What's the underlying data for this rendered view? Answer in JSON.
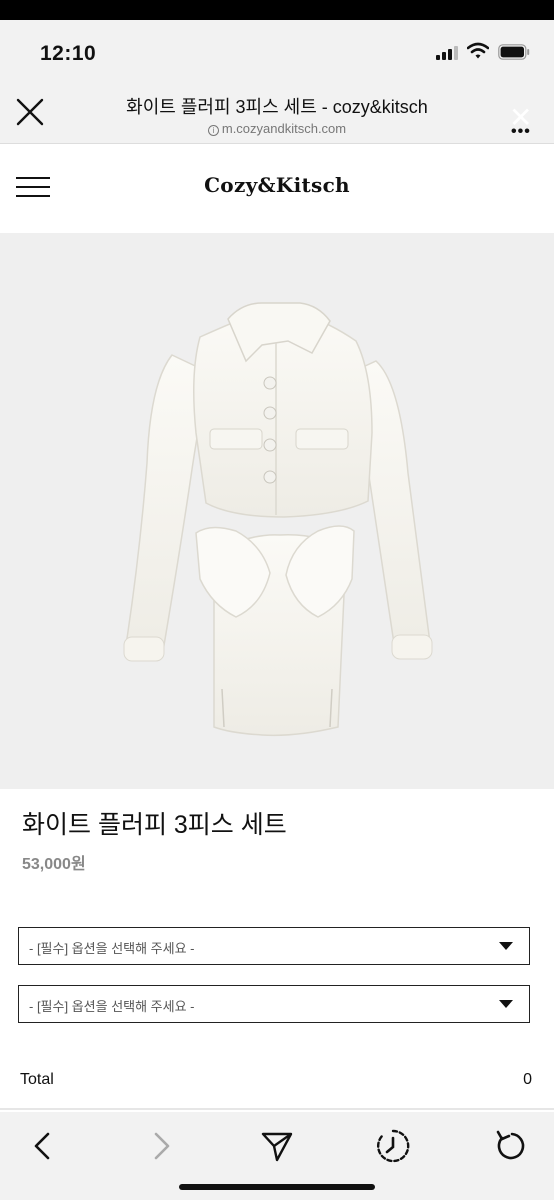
{
  "status_bar": {
    "time": "12:10",
    "icons": [
      "cellular-signal-icon",
      "wifi-icon",
      "battery-icon"
    ]
  },
  "browser": {
    "title": "화이트 플러피 3피스 세트 - cozy&kitsch",
    "url": "m.cozyandkitsch.com",
    "icons": [
      "close-icon",
      "info-icon",
      "more-icon"
    ]
  },
  "site": {
    "logo": "Cozy&Kitsch",
    "icons": [
      "hamburger-menu-icon"
    ]
  },
  "product": {
    "name": "화이트 플러피 3피스 세트",
    "price": "53,000원",
    "image_alt": "white fluffy cropped jacket and skirt set"
  },
  "options": [
    {
      "placeholder": "- [필수] 옵션을 선택해 주세요 -"
    },
    {
      "placeholder": "- [필수] 옵션을 선택해 주세요 -"
    }
  ],
  "total": {
    "label": "Total",
    "value": "0"
  },
  "toolbar": {
    "icons": [
      "back-arrow-icon",
      "forward-arrow-icon",
      "share-icon",
      "history-icon",
      "reload-icon"
    ]
  },
  "colors": {
    "chrome_bg": "#f2f2f2",
    "image_bg": "#efefef",
    "text": "#111111",
    "price": "#888888"
  }
}
